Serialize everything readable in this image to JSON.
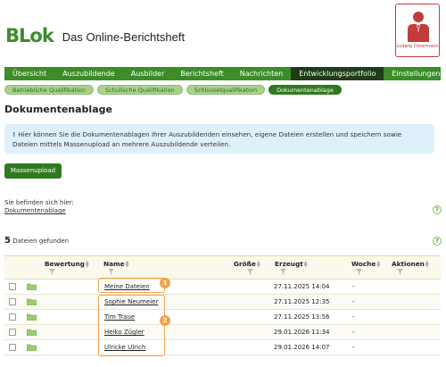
{
  "header": {
    "logo_mark": "BLok",
    "logo_text": "Das Online-Berichtsheft",
    "user_name": "Ludwig Ostermann"
  },
  "nav": {
    "items": [
      {
        "label": "Übersicht"
      },
      {
        "label": "Auszubildende"
      },
      {
        "label": "Ausbilder"
      },
      {
        "label": "Berichtsheft"
      },
      {
        "label": "Nachrichten"
      },
      {
        "label": "Entwicklungsportfolio",
        "active": true
      },
      {
        "label": "Einstellungen"
      }
    ]
  },
  "subnav": {
    "items": [
      {
        "label": "Betriebliche Qualifikation"
      },
      {
        "label": "Schulische Qualifikation"
      },
      {
        "label": "Schlüsselqualifikation"
      },
      {
        "label": "Dokumentenablage",
        "active": true
      }
    ]
  },
  "page": {
    "title": "Dokumentenablage",
    "info_line1": "Hier können Sie die Dokumentenablagen Ihrer Auszubildenden einsehen, eigene Dateien erstellen und speichern sowie",
    "info_line2": "Dateien mittels Massenupload an mehrere Auszubildende verteilen.",
    "upload_button": "Massenupload",
    "location_label": "Sie befinden sich hier:",
    "location_link": "Dokumentenablage",
    "help": "?",
    "count_number": "5",
    "count_text": "Dateien gefunden"
  },
  "table": {
    "columns": {
      "bewertung": "Bewertung",
      "name": "Name",
      "groesse": "Größe",
      "erzeugt": "Erzeugt",
      "woche": "Woche",
      "aktionen": "Aktionen"
    },
    "rows": [
      {
        "name": "Meine Dateien",
        "size": "",
        "created": "27.11.2025 14:04",
        "week": "-"
      },
      {
        "name": "Sophie Neumeier",
        "size": "",
        "created": "27.11.2025 12:35",
        "week": "-"
      },
      {
        "name": "Tim Traue",
        "size": "",
        "created": "27.11.2025 13:56",
        "week": "-"
      },
      {
        "name": "Heiko Zügler",
        "size": "",
        "created": "29.01.2026 11:34",
        "week": "-"
      },
      {
        "name": "Ulricke Ulrich",
        "size": "",
        "created": "29.01.2026 14:07",
        "week": "-"
      }
    ]
  },
  "annotations": {
    "badge1": "1",
    "badge2": "2"
  },
  "colors": {
    "brand_green": "#3c8c28",
    "nav_active": "#1f3d17",
    "annotation_orange": "#f3a24d",
    "user_red": "#c43b3b"
  }
}
